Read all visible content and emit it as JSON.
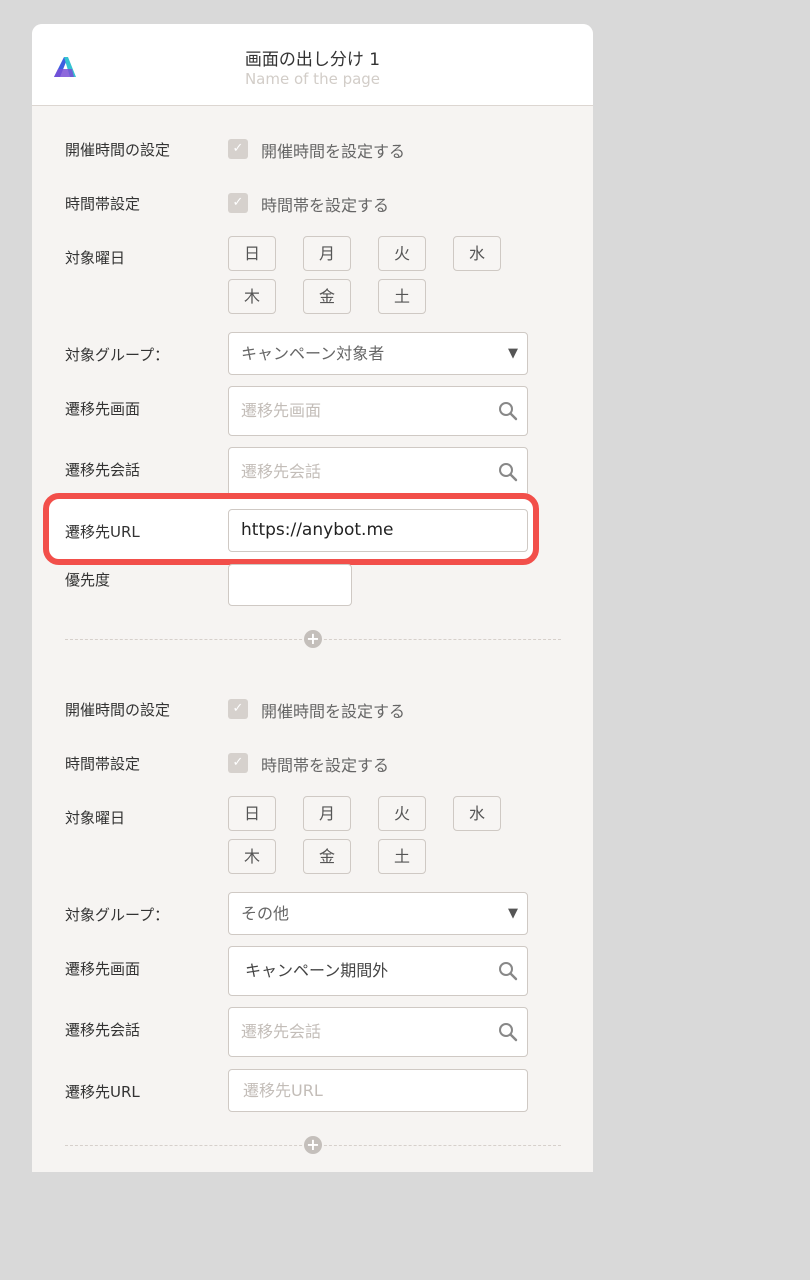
{
  "header": {
    "title": "画面の出し分け 1",
    "subtitle": "Name of the page"
  },
  "days": [
    "日",
    "月",
    "火",
    "水",
    "木",
    "金",
    "土"
  ],
  "rule1": {
    "event_time_label": "開催時間の設定",
    "event_time_checkbox": "開催時間を設定する",
    "time_zone_label": "時間帯設定",
    "time_zone_checkbox": "時間帯を設定する",
    "weekday_label": "対象曜日",
    "group_label": "対象グループ：",
    "group_value": "キャンペーン対象者",
    "screen_label": "遷移先画面",
    "screen_placeholder": "遷移先画面",
    "talk_label": "遷移先会話",
    "talk_placeholder": "遷移先会話",
    "url_label": "遷移先URL",
    "url_value": "https://anybot.me",
    "priority_label": "優先度"
  },
  "rule2": {
    "event_time_label": "開催時間の設定",
    "event_time_checkbox": "開催時間を設定する",
    "time_zone_label": "時間帯設定",
    "time_zone_checkbox": "時間帯を設定する",
    "weekday_label": "対象曜日",
    "group_label": "対象グループ：",
    "group_value": "その他",
    "screen_label": "遷移先画面",
    "screen_value": "キャンペーン期間外",
    "talk_label": "遷移先会話",
    "talk_placeholder": "遷移先会話",
    "url_label": "遷移先URL",
    "url_placeholder": "遷移先URL"
  },
  "icons": {
    "check": "✓",
    "caret": "▼",
    "plus": "+",
    "search": "search-icon",
    "logo": "app-logo"
  },
  "colors": {
    "highlight": "#f24f4a",
    "panel": "#f6f4f2",
    "background": "#d9d9d9"
  }
}
